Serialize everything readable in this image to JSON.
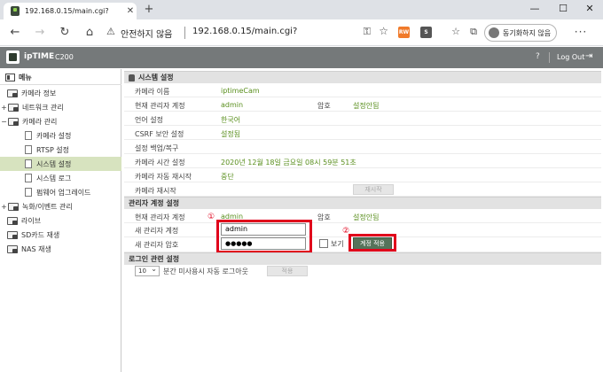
{
  "browser": {
    "tab_title": "192.168.0.15/main.cgi?",
    "tab_close": "✕",
    "new_tab": "+",
    "window_min": "—",
    "window_max": "☐",
    "window_close": "✕",
    "back": "←",
    "forward": "→",
    "reload": "↻",
    "home": "⌂",
    "security_warning": "안전하지 않음",
    "url": "192.168.0.15/main.cgi?",
    "extensions": [
      {
        "text": "RW",
        "color": "#f07a2a"
      },
      {
        "text": "S",
        "color": "#555555"
      }
    ],
    "sync_label": "동기화하지 않음",
    "more": "···"
  },
  "app": {
    "brand": "ipTIME",
    "model": "C200",
    "help": "?",
    "logout": "Log Out"
  },
  "sidebar": {
    "title": "메뉴",
    "items": [
      {
        "label": "카메라 정보",
        "toggle": ""
      },
      {
        "label": "네트워크 관리",
        "toggle": "+"
      },
      {
        "label": "카메라 관리",
        "toggle": "−"
      },
      {
        "label": "카메라 설정",
        "toggle": ""
      },
      {
        "label": "RTSP 설정",
        "toggle": ""
      },
      {
        "label": "시스템 설정",
        "toggle": ""
      },
      {
        "label": "시스템 로그",
        "toggle": ""
      },
      {
        "label": "펌웨어 업그레이드",
        "toggle": ""
      },
      {
        "label": "녹화/이벤트 관리",
        "toggle": "+"
      },
      {
        "label": "라이브",
        "toggle": ""
      },
      {
        "label": "SD카드 재생",
        "toggle": ""
      },
      {
        "label": "NAS 재생",
        "toggle": ""
      }
    ]
  },
  "system": {
    "title": "시스템 설정",
    "rows": [
      {
        "label": "카메라 이름",
        "value": "iptimeCam"
      },
      {
        "label": "현재 관리자 계정",
        "value": "admin",
        "label2": "암호",
        "value2": "설정안됨"
      },
      {
        "label": "언어 설정",
        "value": "한국어"
      },
      {
        "label": "CSRF 보안 설정",
        "value": "설정됨"
      },
      {
        "label": "설정 백업/복구",
        "value": ""
      },
      {
        "label": "카메라 시간 설정",
        "value": "2020년 12월 18일 금요일 08시 59분 51초"
      },
      {
        "label": "카메라 자동 재시작",
        "value": "중단"
      },
      {
        "label": "카메라 재시작",
        "value": ""
      }
    ],
    "restart_button": "재시작"
  },
  "account": {
    "title": "관리자 계정 설정",
    "current_label": "현재 관리자 계정",
    "current_value": "admin",
    "password_label": "암호",
    "password_value": "설정안됨",
    "new_id_label": "새 관리자 계정",
    "new_id_value": "admin",
    "new_pw_label": "새 관리자 암호",
    "new_pw_value": "●●●●●",
    "show_label": "보기",
    "apply_button": "계정 적용",
    "marker1": "①",
    "marker2": "②"
  },
  "logout_setting": {
    "title": "로그인 관련 설정",
    "minutes": "10",
    "suffix": "분간 미사용시 자동 로그아웃",
    "apply_button": "적용"
  },
  "colors": {
    "active_menu": "#d7e3bf",
    "value_green": "#5a8f1e",
    "highlight_red": "#e0001b",
    "header_gray": "#75797a"
  }
}
